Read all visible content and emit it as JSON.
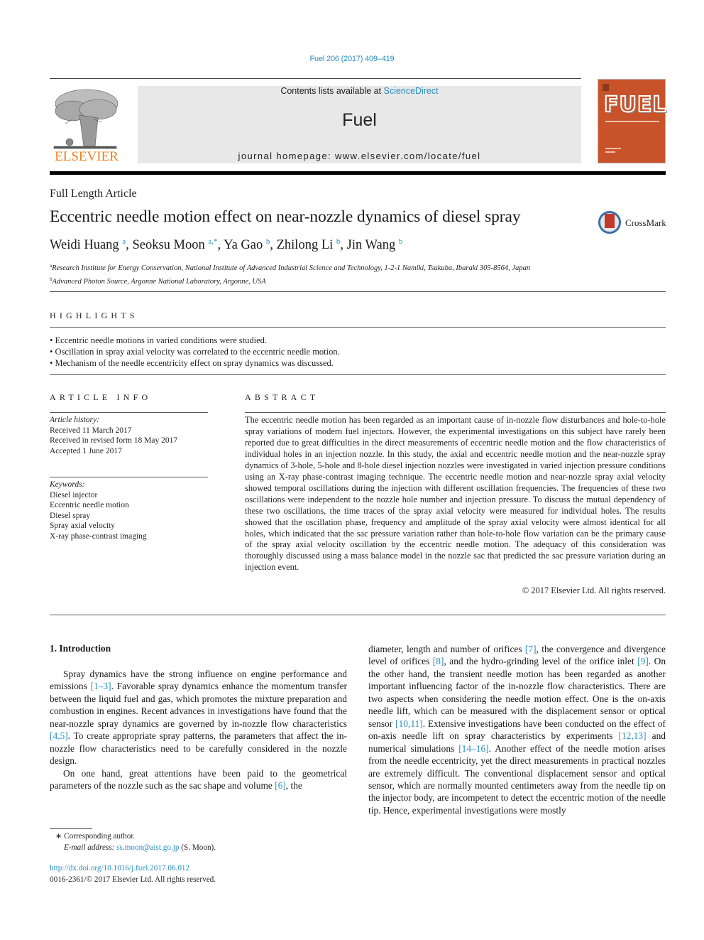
{
  "header": {
    "citation": "Fuel 206 (2017) 409–419",
    "publisher": "ELSEVIER",
    "contents_prefix": "Contents lists available at ",
    "contents_link": "ScienceDirect",
    "journal_name": "Fuel",
    "homepage": "journal homepage: www.elsevier.com/locate/fuel",
    "cover_title": "FUEL",
    "brand_color": "#f07e1b",
    "link_color": "#2a8ec0",
    "cover_color": "#c8532a"
  },
  "article": {
    "type": "Full Length Article",
    "title": "Eccentric needle motion effect on near-nozzle dynamics of diesel spray",
    "crossmark_label": "CrossMark",
    "authors": [
      {
        "name": "Weidi Huang",
        "sup": "a"
      },
      {
        "name": "Seoksu Moon",
        "sup": "a,*"
      },
      {
        "name": "Ya Gao",
        "sup": "b"
      },
      {
        "name": "Zhilong Li",
        "sup": "b"
      },
      {
        "name": "Jin Wang",
        "sup": "b"
      }
    ],
    "affiliations": [
      {
        "mark": "a",
        "text": "Research Institute for Energy Conservation, National Institute of Advanced Industrial Science and Technology, 1-2-1 Namiki, Tsukuba, Ibaraki 305-8564, Japan"
      },
      {
        "mark": "b",
        "text": "Advanced Photon Source, Argonne National Laboratory, Argonne, USA"
      }
    ]
  },
  "highlights": {
    "heading": "HIGHLIGHTS",
    "items": [
      "Eccentric needle motions in varied conditions were studied.",
      "Oscillation in spray axial velocity was correlated to the eccentric needle motion.",
      "Mechanism of the needle eccentricity effect on spray dynamics was discussed."
    ]
  },
  "article_info": {
    "heading": "ARTICLE INFO",
    "history_label": "Article history:",
    "history": [
      "Received 11 March 2017",
      "Received in revised form 18 May 2017",
      "Accepted 1 June 2017"
    ],
    "keywords_label": "Keywords:",
    "keywords": [
      "Diesel injector",
      "Eccentric needle motion",
      "Diesel spray",
      "Spray axial velocity",
      "X-ray phase-contrast imaging"
    ]
  },
  "abstract": {
    "heading": "ABSTRACT",
    "text": "The eccentric needle motion has been regarded as an important cause of in-nozzle flow disturbances and hole-to-hole spray variations of modern fuel injectors. However, the experimental investigations on this subject have rarely been reported due to great difficulties in the direct measurements of eccentric needle motion and the flow characteristics of individual holes in an injection nozzle. In this study, the axial and eccentric needle motion and the near-nozzle spray dynamics of 3-hole, 5-hole and 8-hole diesel injection nozzles were investigated in varied injection pressure conditions using an X-ray phase-contrast imaging technique. The eccentric needle motion and near-nozzle spray axial velocity showed temporal oscilla­tions during the injection with different oscillation frequencies. The frequencies of these two oscillations were independent to the nozzle hole number and injection pressure. To discuss the mutual dependency of these two oscillations, the time traces of the spray axial velocity were measured for individual holes. The results showed that the oscillation phase, frequency and amplitude of the spray axial velocity were almost identical for all holes, which indicated that the sac pressure variation rather than hole-to-hole flow variation can be the primary cause of the spray axial velocity oscillation by the eccentric needle motion. The adequacy of this consideration was thoroughly discussed using a mass balance model in the nozzle sac that predicted the sac pressure variation during an injection event.",
    "copyright": "© 2017 Elsevier Ltd. All rights reserved."
  },
  "body": {
    "intro_heading": "1. Introduction",
    "left_paragraphs": [
      [
        {
          "t": "Spray dynamics have the strong influence on engine perfor­mance and emissions "
        },
        {
          "ref": "[1–3]"
        },
        {
          "t": ". Favorable spray dynamics enhance the momentum transfer between the liquid fuel and gas, which promotes the mixture preparation and combustion in engines. Recent advances in investigations have found that the near-nozzle spray dynamics are governed by in-nozzle flow characteris­tics "
        },
        {
          "ref": "[4,5]"
        },
        {
          "t": ". To create appropriate spray patterns, the parameters that affect the in-nozzle flow characteristics need to be carefully con­sidered in the nozzle design."
        }
      ],
      [
        {
          "t": "On one hand, great attentions have been paid to the geometrical parameters of the nozzle such as the sac shape and volume "
        },
        {
          "ref": "[6]"
        },
        {
          "t": ", the"
        }
      ]
    ],
    "right_paragraph": [
      {
        "t": "diameter, length and number of orifices "
      },
      {
        "ref": "[7]"
      },
      {
        "t": ", the convergence and divergence level of orifices "
      },
      {
        "ref": "[8]"
      },
      {
        "t": ", and the hydro-grinding level of the orifice inlet "
      },
      {
        "ref": "[9]"
      },
      {
        "t": ". On the other hand, the transient needle motion has been regarded as another important influencing factor of the in-nozzle flow characteristics. There are two aspects when consid­ering the needle motion effect. One is the on-axis needle lift, which can be measured with the displacement sensor or optical sensor "
      },
      {
        "ref": "[10,11]"
      },
      {
        "t": ". Extensive investigations have been conducted on the effect of on-axis needle lift on spray characteristics by experiments "
      },
      {
        "ref": "[12,13]"
      },
      {
        "t": " and numerical simulations "
      },
      {
        "ref": "[14–16]"
      },
      {
        "t": ". Another effect of the needle motion arises from the needle eccentricity, yet the direct measurements in practical nozzles are extremely difficult. The con­ventional displacement sensor and optical sensor, which are nor­mally mounted centimeters away from the needle tip on the injector body, are incompetent to detect the eccentric motion of the needle tip. Hence, experimental investigations were mostly"
      }
    ]
  },
  "footnotes": {
    "star": "∗",
    "corresponding": "Corresponding author.",
    "email_label": "E-mail address: ",
    "email": "ss.moon@aist.go.jp",
    "email_suffix": " (S. Moon).",
    "doi": "http://dx.doi.org/10.1016/j.fuel.2017.06.012",
    "issn_line": "0016-2361/© 2017 Elsevier Ltd. All rights reserved."
  }
}
